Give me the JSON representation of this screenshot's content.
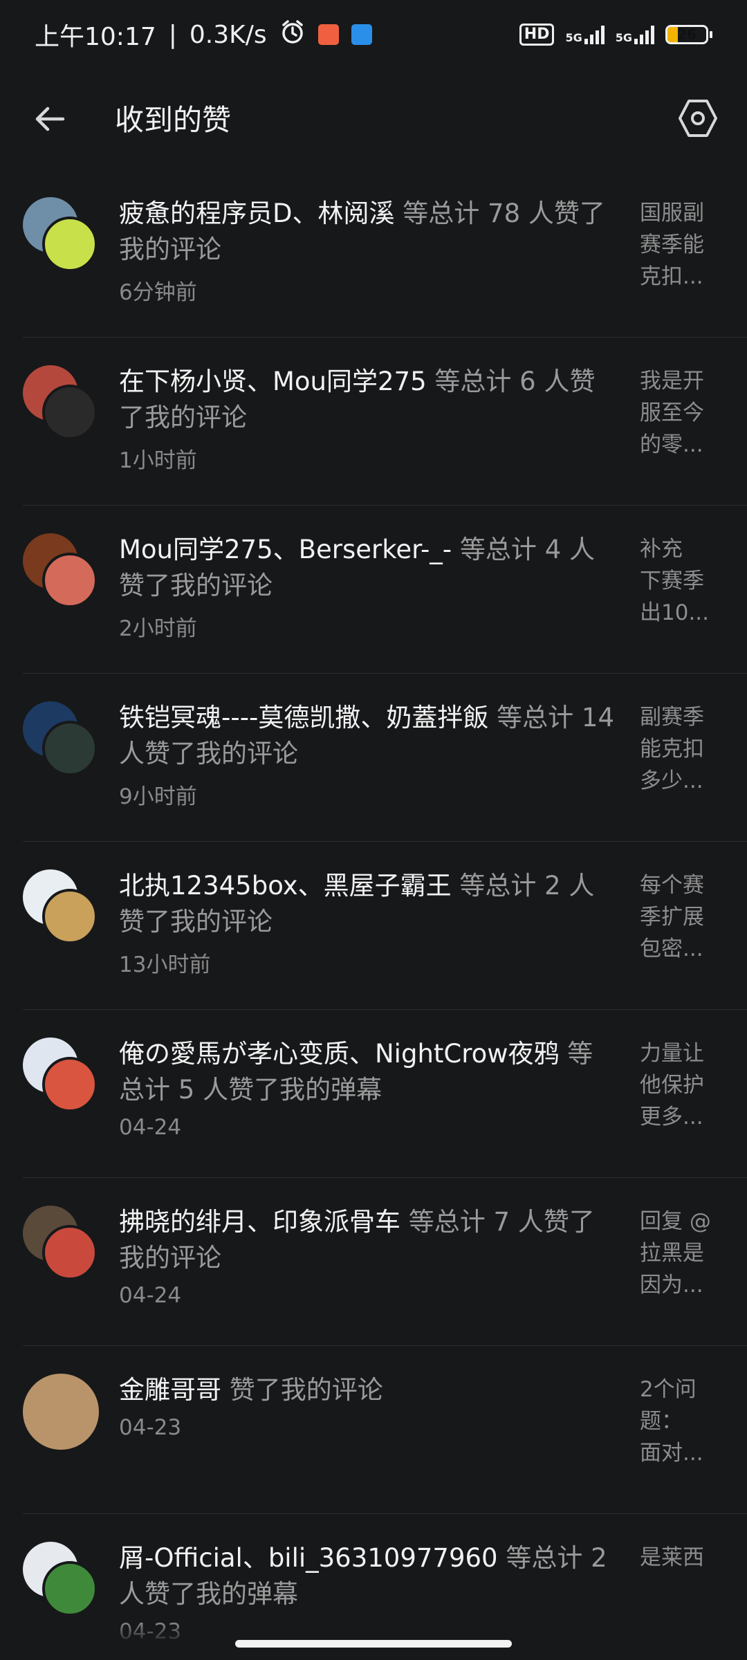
{
  "status_bar": {
    "time": "上午10:17",
    "speed": "0.3K/s",
    "hd": "HD",
    "net1": "5G",
    "net2": "5G",
    "battery": "26"
  },
  "header": {
    "title": "收到的赞"
  },
  "items": [
    {
      "names": "疲惫的程序员D、林阅溪",
      "action": " 等总计 78 人赞了我的评论",
      "time": "6分钟前",
      "preview": [
        "国服副",
        "赛季能",
        "克扣..."
      ],
      "avatar_colors": [
        "#6f8fa8",
        "#c8e04a"
      ]
    },
    {
      "names": "在下杨小贤、Mou同学275",
      "action": " 等总计 6 人赞了我的评论",
      "time": "1小时前",
      "preview": [
        "我是开",
        "服至今",
        "的零..."
      ],
      "avatar_colors": [
        "#b5483c",
        "#2a2a2a"
      ]
    },
    {
      "names": "Mou同学275、Berserker-_-",
      "action": " 等总计 4 人赞了我的评论",
      "time": "2小时前",
      "preview": [
        "补充",
        "下赛季",
        "出10..."
      ],
      "avatar_colors": [
        "#7a3a1e",
        "#d46a5a"
      ]
    },
    {
      "names": "铁铠冥魂----莫德凯撒、奶蓋拌飯",
      "action": " 等总计 14 人赞了我的评论",
      "time": "9小时前",
      "preview": [
        "副赛季",
        "能克扣",
        "多少..."
      ],
      "avatar_colors": [
        "#1d3a63",
        "#2c3a36"
      ]
    },
    {
      "names": "北执12345box、黑屋子霸王",
      "action": " 等总计 2 人赞了我的评论",
      "time": "13小时前",
      "preview": [
        "每个赛",
        "季扩展",
        "包密..."
      ],
      "avatar_colors": [
        "#e8eef2",
        "#c9a15a"
      ]
    },
    {
      "names": "俺の愛馬が孝心变质、NightCrow夜鸦",
      "action": " 等总计 5 人赞了我的弹幕",
      "time": "04-24",
      "preview": [
        "力量让",
        "他保护",
        "更多..."
      ],
      "avatar_colors": [
        "#dfe6ef",
        "#d9553f"
      ]
    },
    {
      "names": "拂晓的绯月、印象派骨车",
      "action": " 等总计 7 人赞了我的评论",
      "time": "04-24",
      "preview": [
        "回复 @",
        "拉黑是",
        "因为..."
      ],
      "avatar_colors": [
        "#5a4a3a",
        "#c94a3c"
      ]
    },
    {
      "names": "金雕哥哥",
      "action": " 赞了我的评论",
      "time": "04-23",
      "preview": [
        "2个问",
        "题：",
        "面对..."
      ],
      "avatar_colors": [
        "#b9946a"
      ]
    },
    {
      "names": "屑-Official、bili_36310977960",
      "action": " 等总计 2 人赞了我的弹幕",
      "time": "04-23",
      "preview": [
        "是莱西"
      ],
      "avatar_colors": [
        "#e6e9ee",
        "#3f8a3a"
      ]
    }
  ]
}
